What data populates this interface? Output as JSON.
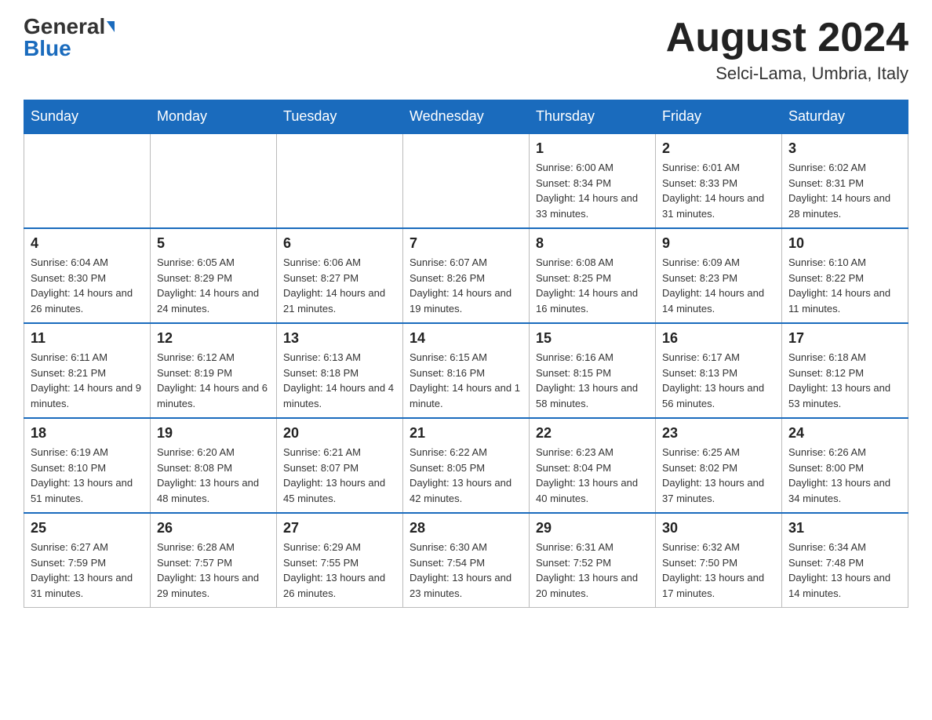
{
  "header": {
    "logo_general": "General",
    "logo_blue": "Blue",
    "month_title": "August 2024",
    "location": "Selci-Lama, Umbria, Italy"
  },
  "days_of_week": [
    "Sunday",
    "Monday",
    "Tuesday",
    "Wednesday",
    "Thursday",
    "Friday",
    "Saturday"
  ],
  "weeks": [
    {
      "days": [
        {
          "number": "",
          "info": ""
        },
        {
          "number": "",
          "info": ""
        },
        {
          "number": "",
          "info": ""
        },
        {
          "number": "",
          "info": ""
        },
        {
          "number": "1",
          "info": "Sunrise: 6:00 AM\nSunset: 8:34 PM\nDaylight: 14 hours and 33 minutes."
        },
        {
          "number": "2",
          "info": "Sunrise: 6:01 AM\nSunset: 8:33 PM\nDaylight: 14 hours and 31 minutes."
        },
        {
          "number": "3",
          "info": "Sunrise: 6:02 AM\nSunset: 8:31 PM\nDaylight: 14 hours and 28 minutes."
        }
      ]
    },
    {
      "days": [
        {
          "number": "4",
          "info": "Sunrise: 6:04 AM\nSunset: 8:30 PM\nDaylight: 14 hours and 26 minutes."
        },
        {
          "number": "5",
          "info": "Sunrise: 6:05 AM\nSunset: 8:29 PM\nDaylight: 14 hours and 24 minutes."
        },
        {
          "number": "6",
          "info": "Sunrise: 6:06 AM\nSunset: 8:27 PM\nDaylight: 14 hours and 21 minutes."
        },
        {
          "number": "7",
          "info": "Sunrise: 6:07 AM\nSunset: 8:26 PM\nDaylight: 14 hours and 19 minutes."
        },
        {
          "number": "8",
          "info": "Sunrise: 6:08 AM\nSunset: 8:25 PM\nDaylight: 14 hours and 16 minutes."
        },
        {
          "number": "9",
          "info": "Sunrise: 6:09 AM\nSunset: 8:23 PM\nDaylight: 14 hours and 14 minutes."
        },
        {
          "number": "10",
          "info": "Sunrise: 6:10 AM\nSunset: 8:22 PM\nDaylight: 14 hours and 11 minutes."
        }
      ]
    },
    {
      "days": [
        {
          "number": "11",
          "info": "Sunrise: 6:11 AM\nSunset: 8:21 PM\nDaylight: 14 hours and 9 minutes."
        },
        {
          "number": "12",
          "info": "Sunrise: 6:12 AM\nSunset: 8:19 PM\nDaylight: 14 hours and 6 minutes."
        },
        {
          "number": "13",
          "info": "Sunrise: 6:13 AM\nSunset: 8:18 PM\nDaylight: 14 hours and 4 minutes."
        },
        {
          "number": "14",
          "info": "Sunrise: 6:15 AM\nSunset: 8:16 PM\nDaylight: 14 hours and 1 minute."
        },
        {
          "number": "15",
          "info": "Sunrise: 6:16 AM\nSunset: 8:15 PM\nDaylight: 13 hours and 58 minutes."
        },
        {
          "number": "16",
          "info": "Sunrise: 6:17 AM\nSunset: 8:13 PM\nDaylight: 13 hours and 56 minutes."
        },
        {
          "number": "17",
          "info": "Sunrise: 6:18 AM\nSunset: 8:12 PM\nDaylight: 13 hours and 53 minutes."
        }
      ]
    },
    {
      "days": [
        {
          "number": "18",
          "info": "Sunrise: 6:19 AM\nSunset: 8:10 PM\nDaylight: 13 hours and 51 minutes."
        },
        {
          "number": "19",
          "info": "Sunrise: 6:20 AM\nSunset: 8:08 PM\nDaylight: 13 hours and 48 minutes."
        },
        {
          "number": "20",
          "info": "Sunrise: 6:21 AM\nSunset: 8:07 PM\nDaylight: 13 hours and 45 minutes."
        },
        {
          "number": "21",
          "info": "Sunrise: 6:22 AM\nSunset: 8:05 PM\nDaylight: 13 hours and 42 minutes."
        },
        {
          "number": "22",
          "info": "Sunrise: 6:23 AM\nSunset: 8:04 PM\nDaylight: 13 hours and 40 minutes."
        },
        {
          "number": "23",
          "info": "Sunrise: 6:25 AM\nSunset: 8:02 PM\nDaylight: 13 hours and 37 minutes."
        },
        {
          "number": "24",
          "info": "Sunrise: 6:26 AM\nSunset: 8:00 PM\nDaylight: 13 hours and 34 minutes."
        }
      ]
    },
    {
      "days": [
        {
          "number": "25",
          "info": "Sunrise: 6:27 AM\nSunset: 7:59 PM\nDaylight: 13 hours and 31 minutes."
        },
        {
          "number": "26",
          "info": "Sunrise: 6:28 AM\nSunset: 7:57 PM\nDaylight: 13 hours and 29 minutes."
        },
        {
          "number": "27",
          "info": "Sunrise: 6:29 AM\nSunset: 7:55 PM\nDaylight: 13 hours and 26 minutes."
        },
        {
          "number": "28",
          "info": "Sunrise: 6:30 AM\nSunset: 7:54 PM\nDaylight: 13 hours and 23 minutes."
        },
        {
          "number": "29",
          "info": "Sunrise: 6:31 AM\nSunset: 7:52 PM\nDaylight: 13 hours and 20 minutes."
        },
        {
          "number": "30",
          "info": "Sunrise: 6:32 AM\nSunset: 7:50 PM\nDaylight: 13 hours and 17 minutes."
        },
        {
          "number": "31",
          "info": "Sunrise: 6:34 AM\nSunset: 7:48 PM\nDaylight: 13 hours and 14 minutes."
        }
      ]
    }
  ]
}
